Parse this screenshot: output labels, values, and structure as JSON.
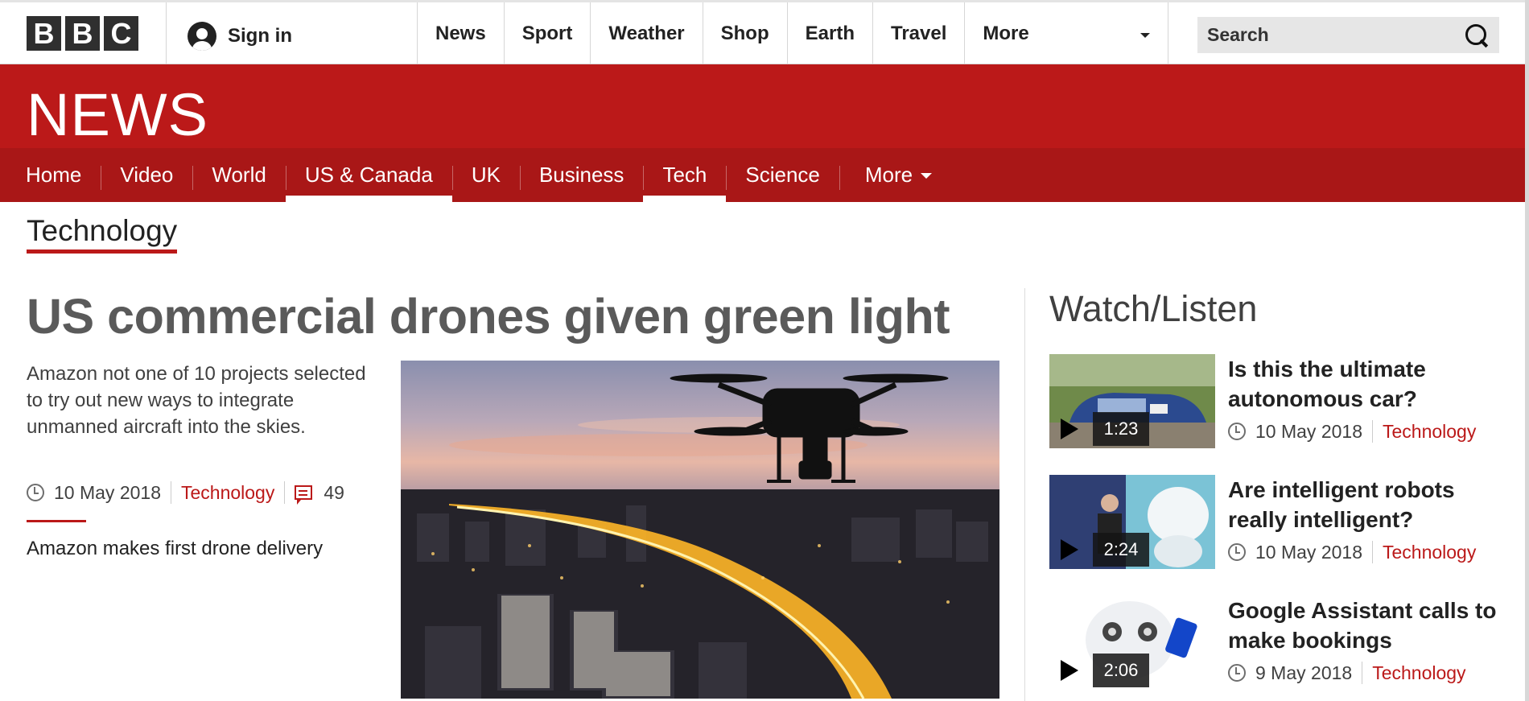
{
  "topbar": {
    "logo": [
      "B",
      "B",
      "C"
    ],
    "signin_label": "Sign in",
    "nav": [
      "News",
      "Sport",
      "Weather",
      "Shop",
      "Earth",
      "Travel"
    ],
    "more_label": "More",
    "search_placeholder": "Search"
  },
  "news_header": {
    "title": "NEWS",
    "nav": [
      {
        "label": "Home",
        "active": false
      },
      {
        "label": "Video",
        "active": false
      },
      {
        "label": "World",
        "active": false
      },
      {
        "label": "US & Canada",
        "active": true
      },
      {
        "label": "UK",
        "active": false
      },
      {
        "label": "Business",
        "active": false
      },
      {
        "label": "Tech",
        "active": true
      },
      {
        "label": "Science",
        "active": false
      }
    ],
    "more_label": "More"
  },
  "section": {
    "title": "Technology"
  },
  "main_story": {
    "headline": "US commercial drones given green light",
    "summary": "Amazon not one of 10 projects selected to try out new ways to integrate unmanned aircraft into the skies.",
    "date": "10 May 2018",
    "category": "Technology",
    "comments": "49",
    "related": "Amazon makes first drone delivery"
  },
  "watch_listen": {
    "title": "Watch/Listen",
    "items": [
      {
        "headline": "Is this the ultimate autonomous car?",
        "duration": "1:23",
        "date": "10 May 2018",
        "category": "Technology"
      },
      {
        "headline": "Are intelligent robots really intelligent?",
        "duration": "2:24",
        "date": "10 May 2018",
        "category": "Technology"
      },
      {
        "headline": "Google Assistant calls to make bookings",
        "duration": "2:06",
        "date": "9 May 2018",
        "category": "Technology"
      }
    ]
  },
  "colors": {
    "brand_red": "#bb1919",
    "nav_red": "#a91717",
    "text_dark": "#222222",
    "headline_gray": "#5a5a5a"
  }
}
